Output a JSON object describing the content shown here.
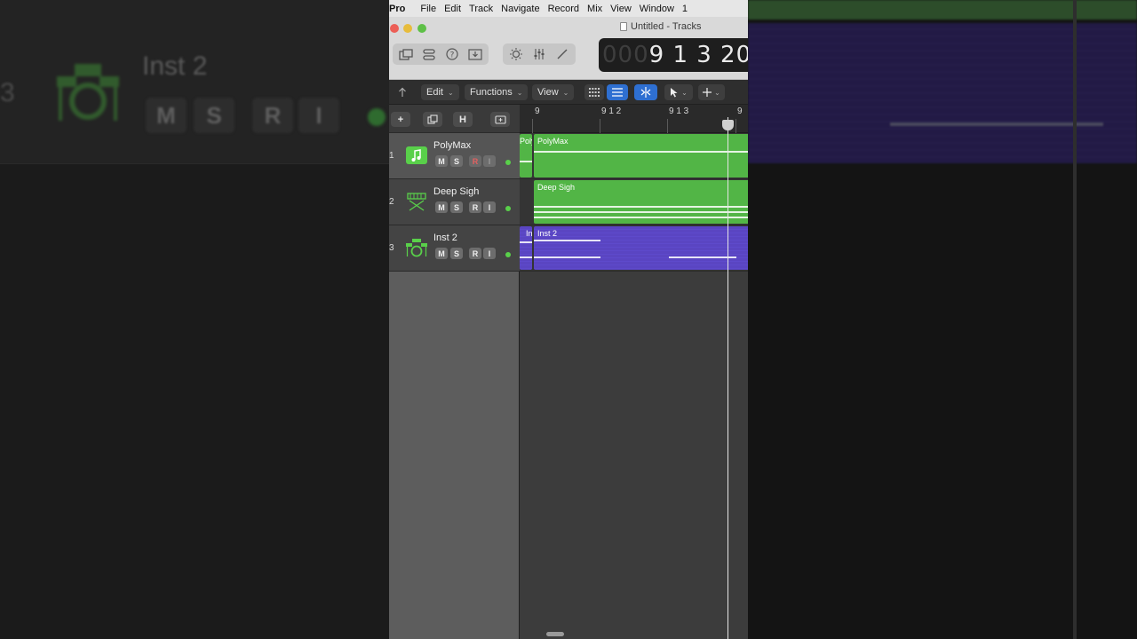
{
  "menubar": {
    "app": "Pro",
    "items": [
      "File",
      "Edit",
      "Track",
      "Navigate",
      "Record",
      "Mix",
      "View",
      "Window",
      "1"
    ]
  },
  "window": {
    "title": "Untitled - Tracks"
  },
  "lcd": {
    "dim": "000",
    "position": "9 1 3 20"
  },
  "controlbar": {
    "edit": "Edit",
    "functions": "Functions",
    "view": "View"
  },
  "trackbar": {
    "add": "+",
    "hide": "H"
  },
  "ruler": {
    "ticks": [
      "9",
      "9 1 2",
      "9 1 3",
      "9"
    ]
  },
  "tracks": [
    {
      "number": "1",
      "name": "PolyMax",
      "icon": "music-note-icon",
      "region": "PolyMax",
      "region_prev": "Poly",
      "m": "M",
      "s": "S",
      "r": "R",
      "i": "I"
    },
    {
      "number": "2",
      "name": "Deep Sigh",
      "icon": "keyboard-icon",
      "region": "Deep Sigh",
      "m": "M",
      "s": "S",
      "r": "R",
      "i": "I"
    },
    {
      "number": "3",
      "name": "Inst 2",
      "icon": "drum-kit-icon",
      "region": "Inst 2",
      "region_prev": "In",
      "m": "M",
      "s": "S",
      "r": "R",
      "i": "I"
    }
  ],
  "background": {
    "track_number": "3",
    "track_name": "Inst 2",
    "buttons": [
      "M",
      "S",
      "R",
      "I"
    ]
  },
  "colors": {
    "region_green": "#52b546",
    "region_purple": "#5a45c2",
    "led_green": "#59d04a",
    "selected_blue": "#2e6fd1"
  }
}
